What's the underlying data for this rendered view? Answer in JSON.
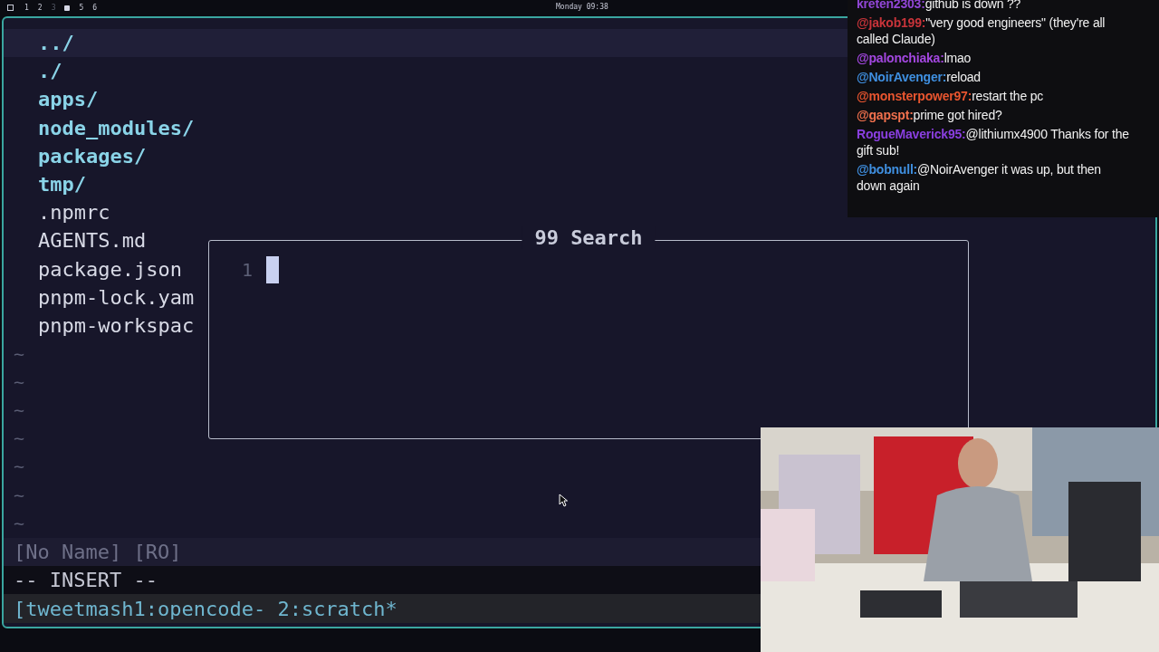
{
  "top_bar": {
    "workspaces": [
      {
        "label": "1",
        "selected": false,
        "occupied": true
      },
      {
        "label": "2",
        "selected": false,
        "occupied": true
      },
      {
        "label": "3",
        "selected": false,
        "occupied": false
      },
      {
        "selected": true
      },
      {
        "label": "5",
        "selected": false,
        "occupied": true
      },
      {
        "label": "6",
        "selected": false,
        "occupied": true
      }
    ],
    "clock": "Monday 09:38"
  },
  "editor": {
    "entries": [
      {
        "name": "../",
        "kind": "dir",
        "selected": true
      },
      {
        "name": "./",
        "kind": "dir",
        "selected": false
      },
      {
        "name": "apps/",
        "kind": "dir",
        "selected": false
      },
      {
        "name": "node_modules/",
        "kind": "dir",
        "selected": false
      },
      {
        "name": "packages/",
        "kind": "dir",
        "selected": false
      },
      {
        "name": "tmp/",
        "kind": "dir",
        "selected": false
      },
      {
        "name": ".npmrc",
        "kind": "file",
        "selected": false
      },
      {
        "name": "AGENTS.md",
        "kind": "file",
        "selected": false
      },
      {
        "name": "package.json",
        "kind": "file",
        "selected": false
      },
      {
        "name": "pnpm-lock.yam",
        "kind": "file",
        "selected": false
      },
      {
        "name": "pnpm-workspac",
        "kind": "file",
        "selected": false
      }
    ],
    "empty_lines": [
      "~",
      "~",
      "~",
      "~",
      "~",
      "~",
      "~"
    ],
    "status_line": "[No Name] [RO]",
    "mode": "-- INSERT --",
    "tmux_bar": "[tweetmash1:opencode- 2:scratch*"
  },
  "search_popup": {
    "title": "99 Search",
    "line_number": "1"
  },
  "chat": {
    "messages": [
      {
        "user": "kreten2303:",
        "text": "github is down ??",
        "color": "#9146d6"
      },
      {
        "user": "@jakob199:",
        "text": "\"very good engineers\" (they're all called Claude)",
        "color": "#c8343a"
      },
      {
        "user": "@palonchiaka:",
        "text": "lmao",
        "color": "#a347e0"
      },
      {
        "user": "@NoirAvenger:",
        "text": "reload",
        "color": "#3f8fe0"
      },
      {
        "user": "@monsterpower97:",
        "text": "restart the pc",
        "color": "#e8552f"
      },
      {
        "user": "@gapspt:",
        "text": "prime got hired?",
        "color": "#f0704d"
      },
      {
        "user": "RogueMaverick95:",
        "text": "@lithiumx4900 Thanks for the gift sub!",
        "color": "#8a3fe0"
      },
      {
        "user": "@bobnull:",
        "text": "@NoirAvenger it was up, but then down again",
        "color": "#3f8fe0"
      }
    ]
  }
}
